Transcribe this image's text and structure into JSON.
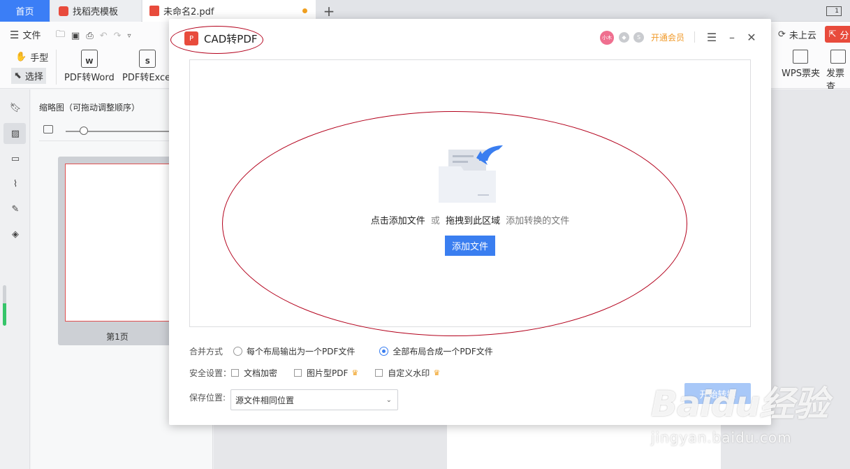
{
  "tabs": {
    "home": "首页",
    "template": "找稻壳模板",
    "document": "未命名2.pdf",
    "new_tab": "+",
    "window_count": "1"
  },
  "toolbar": {
    "file_menu": "文件",
    "hand_tool": "手型",
    "select_tool": "选择",
    "pdf_to_word": "PDF转Word",
    "pdf_to_excel": "PDF转Excel",
    "not_synced": "未上云",
    "share": "分",
    "wps_invoice": "WPS票夹",
    "invoice_check": "发票查",
    "word_icon_letter": "W",
    "excel_icon_letter": "S"
  },
  "thumbnail_panel": {
    "title": "缩略图（可拖动调整顺序）",
    "page_label": "第1页"
  },
  "dialog": {
    "title": "CAD转PDF",
    "logo_glyph": "P",
    "avatar_text": "小木",
    "member_link": "开通会员",
    "drop_text_1": "点击添加文件",
    "drop_text_or": "或",
    "drop_text_2": "拖拽到此区域",
    "drop_text_3": "添加转换的文件",
    "add_file_button": "添加文件",
    "merge_label": "合并方式",
    "merge_option_1": "每个布局输出为一个PDF文件",
    "merge_option_2": "全部布局合成一个PDF文件",
    "security_label": "安全设置：",
    "security_encrypt": "文档加密",
    "security_image_pdf": "图片型PDF",
    "security_watermark": "自定义水印",
    "save_label": "保存位置:",
    "save_value": "源文件相同位置",
    "start_button": "开始转换"
  },
  "watermark": {
    "main": "Baidu经验",
    "sub": "jingyan.baidu.com"
  },
  "colors": {
    "accent": "#3a7ef0",
    "member": "#f09a2a",
    "annotation": "#b3001b",
    "brand_red": "#e84b3c"
  }
}
